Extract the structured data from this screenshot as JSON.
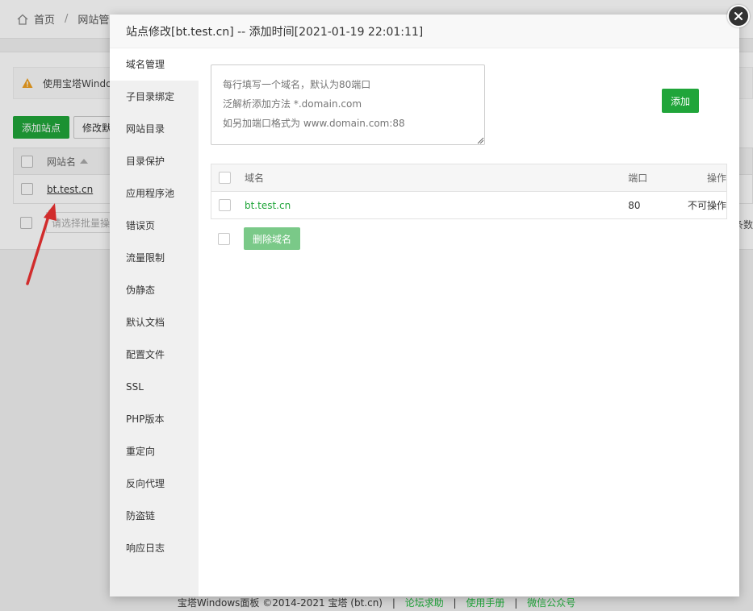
{
  "background": {
    "breadcrumb": {
      "home": "首页",
      "separator": "/",
      "current": "网站管"
    },
    "warning": "使用宝塔Windo",
    "add_site_button": "添加站点",
    "edit_button": "修改默",
    "table": {
      "col_site_name": "网站名",
      "site_link": "bt.test.cn"
    },
    "batch_placeholder": "请选择批量操作",
    "count_suffix": "条数"
  },
  "footer": {
    "copyright": "宝塔Windows面板 ©2014-2021 宝塔 (bt.cn)",
    "separator": "|",
    "links": [
      "论坛求助",
      "使用手册",
      "微信公众号"
    ]
  },
  "modal": {
    "title": "站点修改[bt.test.cn] -- 添加时间[2021-01-19 22:01:11]",
    "nav": [
      "域名管理",
      "子目录绑定",
      "网站目录",
      "目录保护",
      "应用程序池",
      "错误页",
      "流量限制",
      "伪静态",
      "默认文档",
      "配置文件",
      "SSL",
      "PHP版本",
      "重定向",
      "反向代理",
      "防盗链",
      "响应日志"
    ],
    "active_nav_index": 0,
    "domain_input": {
      "value": "",
      "placeholder": "每行填写一个域名，默认为80端口\n泛解析添加方法 *.domain.com\n如另加端口格式为 www.domain.com:88"
    },
    "add_button": "添加",
    "table": {
      "headers": {
        "domain": "域名",
        "port": "端口",
        "action": "操作"
      },
      "rows": [
        {
          "domain": "bt.test.cn",
          "port": "80",
          "action": "不可操作"
        }
      ]
    },
    "delete_button": "删除域名"
  },
  "colors": {
    "accent": "#20a53a",
    "disabled_accent": "#7ac988"
  }
}
